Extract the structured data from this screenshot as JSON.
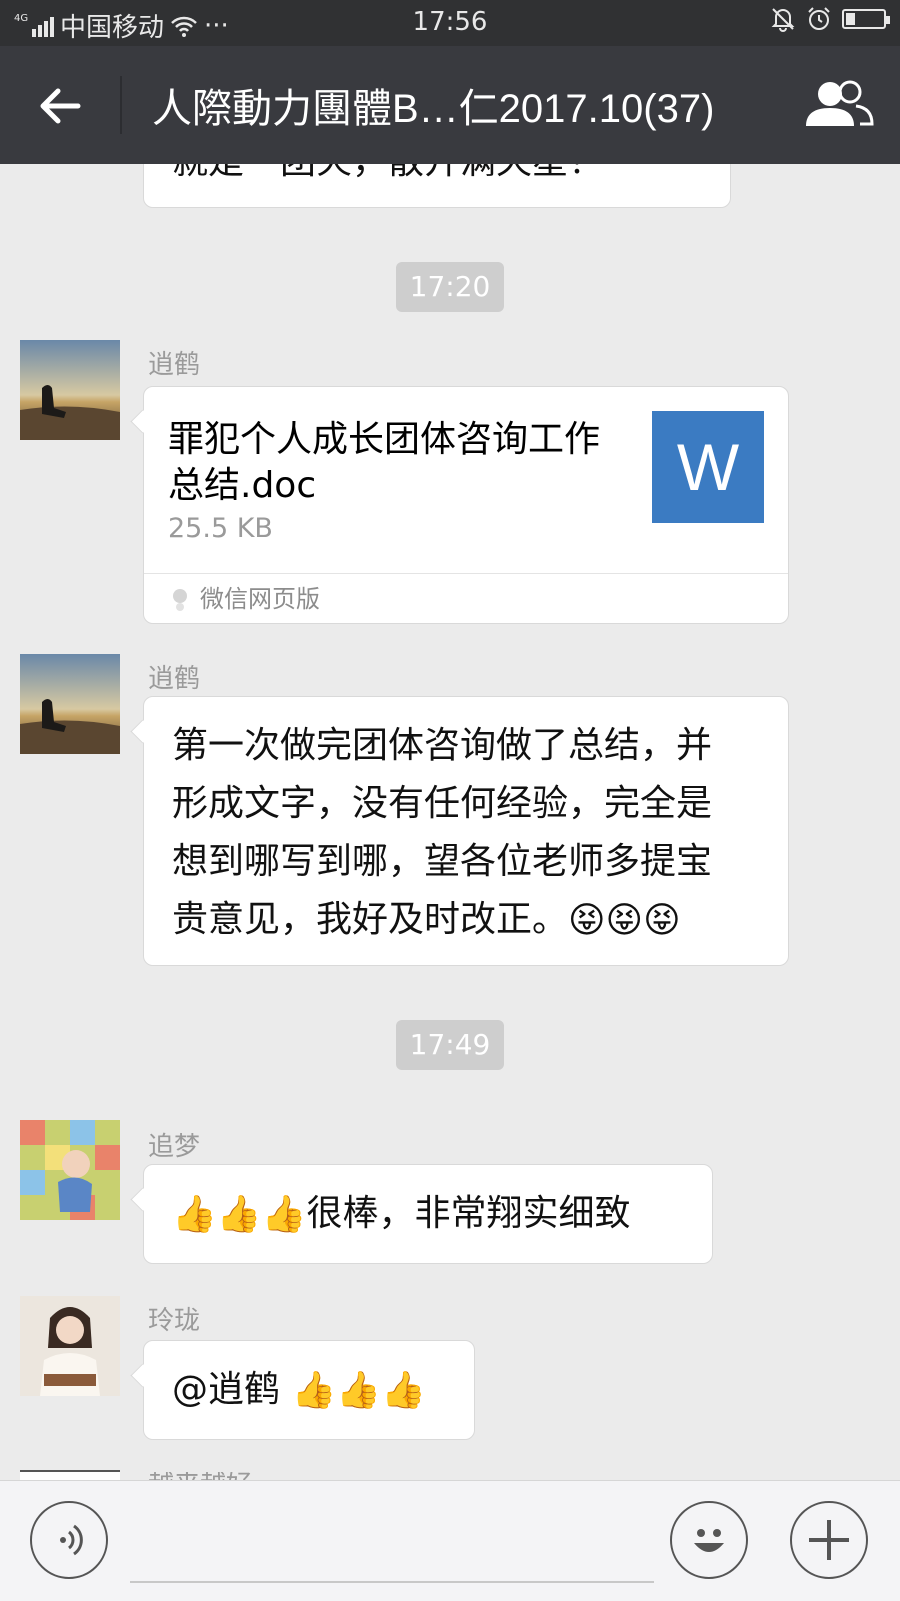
{
  "status_bar": {
    "network_type": "4G",
    "carrier": "中国移动",
    "more": "···",
    "time": "17:56",
    "battery_level": 0.25
  },
  "title_bar": {
    "title": "人際動力團體B…仁2017.10(37)"
  },
  "messages": {
    "cut_off_text": "就是一团火，散开满天星！",
    "time1": "17:20",
    "msg1": {
      "sender": "逍鹤",
      "file_name": "罪犯个人成长团体咨询工作总结.doc",
      "file_size": "25.5 KB",
      "file_icon_letter": "W",
      "source": "微信网页版"
    },
    "msg2": {
      "sender": "逍鹤",
      "text_lines": [
        "第一次做完团体咨询做了总结，并",
        "形成文字，没有任何经验，完全是",
        "想到哪写到哪，望各位老师多提宝",
        "贵意见，我好及时改正。"
      ],
      "emoji": "😝😝😝"
    },
    "time2": "17:49",
    "msg3": {
      "sender": "追梦",
      "emoji": "👍👍👍",
      "text": "很棒，非常翔实细致"
    },
    "msg4": {
      "sender": "玲珑",
      "text": "@逍鹤",
      "emoji": "👍👍👍"
    },
    "msg5_sender_partial": "越来越好"
  },
  "input_bar": {
    "placeholder": ""
  },
  "colors": {
    "titlebar_bg": "#393a3f",
    "statusbar_bg": "#303133",
    "chat_bg": "#ebebeb",
    "word_icon": "#3b7bc2"
  },
  "icons": [
    "back-arrow-icon",
    "group-members-icon",
    "wifi-icon",
    "bell-muted-icon",
    "alarm-icon",
    "battery-icon",
    "voice-icon",
    "emoji-icon",
    "plus-icon",
    "wechat-web-icon",
    "thumbs-up-emoji",
    "tongue-out-emoji"
  ]
}
